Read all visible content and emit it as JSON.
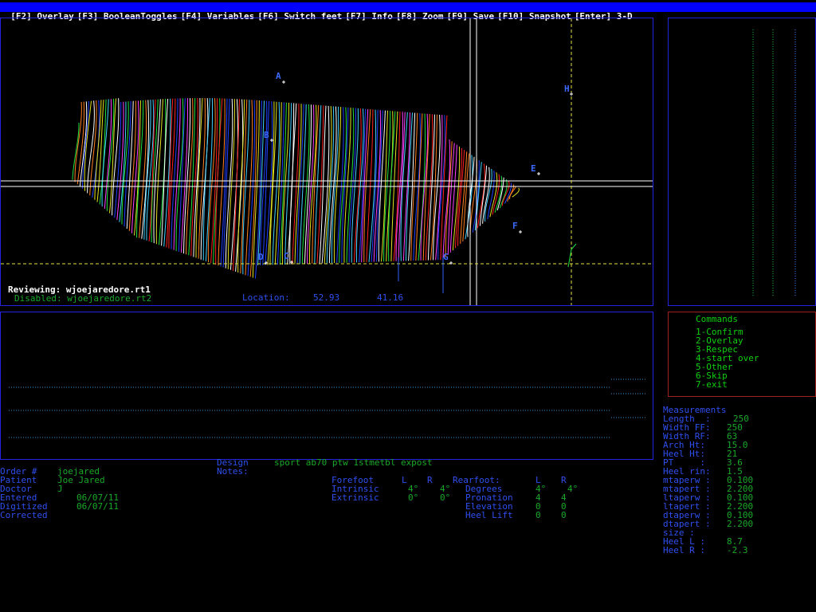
{
  "menu": [
    "[F2] Overlay",
    "[F3] BooleanToggles",
    "[F4] Variables",
    "[F6] Switch feet",
    "[F7] Info",
    "[F8] Zoom",
    "[F9] Save",
    "[F10] Snapshot",
    "[Enter] 3-D"
  ],
  "scan": {
    "reviewing_label": "Reviewing:",
    "reviewing_file": "wjoejaredore.rt1",
    "disabled_label": "Disabled:",
    "disabled_file": "wjoejaredore.rt2",
    "location_label": "Location:",
    "location_x": "52.93",
    "location_y": "41.16",
    "point_labels": [
      "A",
      "B",
      "E",
      "H",
      "F",
      "D",
      "C",
      "G"
    ]
  },
  "commands": {
    "title": "Commands",
    "items": [
      "1-Confirm",
      "2-Overlay",
      "3-Respec",
      "4-start over",
      "5-Other",
      "6-Skip",
      "7-exit"
    ]
  },
  "measurements": {
    "title": "Measurements",
    "rows": [
      {
        "label": "Length  :",
        "value": "250"
      },
      {
        "label": "Width FF:",
        "value": "250"
      },
      {
        "label": "Width RF:",
        "value": "63"
      },
      {
        "label": "Arch Ht:",
        "value": "15.0"
      },
      {
        "label": "Heel Ht:",
        "value": "21"
      },
      {
        "label": "PT     :",
        "value": "3.6"
      },
      {
        "label": "Heel rin:",
        "value": "1.5"
      },
      {
        "label": "mtaperw :",
        "value": "0.100"
      },
      {
        "label": "mtapert :",
        "value": "2.200"
      },
      {
        "label": "ltaperw :",
        "value": "0.100"
      },
      {
        "label": "ltapert :",
        "value": "2.200"
      },
      {
        "label": "dtaperw :",
        "value": "0.100"
      },
      {
        "label": "dtapert :",
        "value": "2.200"
      },
      {
        "label": "size :",
        "value": ""
      },
      {
        "label": "Heel L :",
        "value": "8.7"
      },
      {
        "label": "Heel R :",
        "value": "-2.3"
      }
    ]
  },
  "order": {
    "labels": [
      "Order #",
      "Patient",
      "Doctor",
      "Entered",
      "Digitized",
      "Corrected"
    ],
    "values": [
      "joejared",
      "Joe Jared",
      "J",
      "06/07/11",
      "06/07/11",
      ""
    ]
  },
  "design": {
    "design_label": "Design",
    "design_value": "sport ab70 ptw 1stmetbl expost",
    "notes_label": "Notes:"
  },
  "forefoot": {
    "header": "Forefoot",
    "col_l": "L",
    "col_r": "R",
    "rows": [
      {
        "label": "Intrinsic",
        "l": "4°",
        "r": "4°"
      },
      {
        "label": "Extrinsic",
        "l": "0°",
        "r": "0°"
      }
    ]
  },
  "rearfoot": {
    "header": "Rearfoot:",
    "col_l": "L",
    "col_r": "R",
    "rows": [
      {
        "label": "Degrees",
        "l": "4°",
        "r": "4°"
      },
      {
        "label": "Pronation",
        "l": "4",
        "r": "4"
      },
      {
        "label": "Elevation",
        "l": "0",
        "r": "0"
      },
      {
        "label": "Heel Lift",
        "l": "0",
        "r": "0"
      }
    ]
  },
  "colors": {
    "menu_bg": "#0000ff",
    "panel_border": "#2424e0",
    "label_blue": "#2f4ff0",
    "value_green": "#1aa82a",
    "command_green": "#10d010"
  }
}
